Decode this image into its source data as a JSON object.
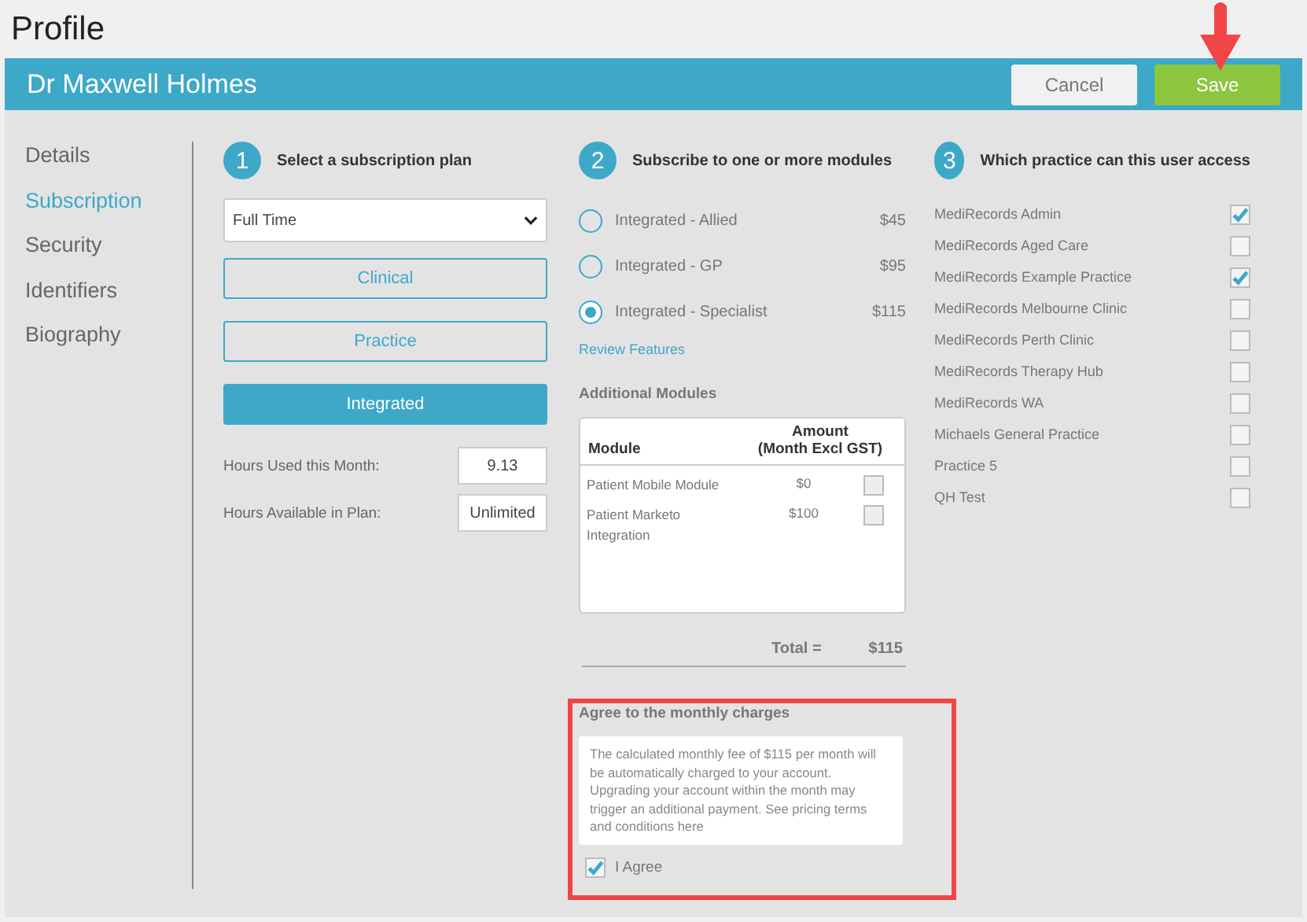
{
  "page_title": "Profile",
  "header": {
    "name": "Dr Maxwell Holmes",
    "buttons": [
      {
        "label": "Cancel",
        "kind": "secondary"
      },
      {
        "label": "Save",
        "kind": "primary"
      }
    ]
  },
  "sidebar": {
    "items": [
      {
        "label": "Details",
        "selected": false
      },
      {
        "label": "Subscription",
        "selected": true
      },
      {
        "label": "Security",
        "selected": false
      },
      {
        "label": "Identifiers",
        "selected": false
      },
      {
        "label": "Biography",
        "selected": false
      }
    ]
  },
  "plan": {
    "step": "1",
    "title": "Select a subscription plan",
    "dropdown": "Full Time",
    "options": [
      {
        "label": "Clinical",
        "selected": false
      },
      {
        "label": "Practice",
        "selected": false
      },
      {
        "label": "Integrated",
        "selected": true
      }
    ],
    "fields": [
      {
        "label": "Hours Used this Month:",
        "value": "9.13"
      },
      {
        "label": "Hours Available in Plan:",
        "value": "Unlimited"
      }
    ]
  },
  "modules": {
    "step": "2",
    "title": "Subscribe to one or more modules",
    "options": [
      {
        "label": "Integrated - Allied",
        "price": "$45",
        "selected": false
      },
      {
        "label": "Integrated - GP",
        "price": "$95",
        "selected": false
      },
      {
        "label": "Integrated - Specialist",
        "price": "$115",
        "selected": true
      }
    ],
    "link": "Review Features",
    "additional_title": "Additional Modules",
    "table": {
      "columns": [
        "Module",
        "Amount\n(Month Excl GST)"
      ],
      "rows": [
        {
          "module": "Patient Mobile Module",
          "amount": "$0",
          "checked": false
        },
        {
          "module": "Patient Marketo Integration",
          "amount": "$100",
          "checked": false
        }
      ]
    },
    "total_label": "Total =",
    "total": "$115"
  },
  "agree": {
    "title": "Agree to the monthly charges",
    "text": "The calculated monthly fee of $115 per month will be automatically charged to your account. Upgrading your account within the month may trigger an additional payment. See pricing terms and conditions here",
    "checkbox": {
      "label": "I Agree",
      "checked": true
    }
  },
  "practices": {
    "step": "3",
    "title": "Which practice can this user access",
    "items": [
      {
        "label": "MediRecords Admin",
        "checked": true
      },
      {
        "label": "MediRecords Aged Care",
        "checked": false
      },
      {
        "label": "MediRecords Example Practice",
        "checked": true
      },
      {
        "label": "MediRecords Melbourne Clinic",
        "checked": false
      },
      {
        "label": "MediRecords Perth Clinic",
        "checked": false
      },
      {
        "label": "MediRecords Therapy Hub",
        "checked": false
      },
      {
        "label": "MediRecords WA",
        "checked": false
      },
      {
        "label": "Michaels General Practice",
        "checked": false
      },
      {
        "label": "Practice 5",
        "checked": false
      },
      {
        "label": "QH Test",
        "checked": false
      }
    ]
  }
}
